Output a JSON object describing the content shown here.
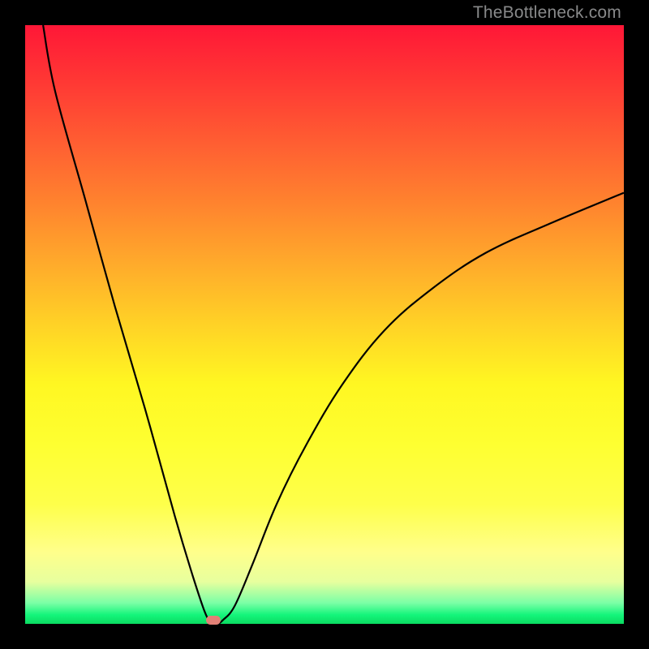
{
  "watermark": "TheBottleneck.com",
  "chart_data": {
    "type": "line",
    "title": "",
    "xlabel": "",
    "ylabel": "",
    "xlim": [
      0,
      100
    ],
    "ylim": [
      0,
      100
    ],
    "grid": false,
    "legend": false,
    "series": [
      {
        "name": "bottleneck-curve",
        "x": [
          3,
          5,
          10,
          15,
          20,
          25,
          28,
          30,
          31,
          32,
          33,
          35,
          38,
          42,
          47,
          53,
          60,
          68,
          77,
          88,
          100
        ],
        "y": [
          100,
          89,
          71,
          53,
          36,
          18,
          8,
          2,
          0.4,
          0,
          0.6,
          3,
          10,
          20,
          30,
          40,
          49,
          56,
          62,
          67,
          72
        ]
      }
    ],
    "annotations": [
      {
        "name": "min-marker",
        "x": 31.5,
        "y": 0.5,
        "color": "#e28076"
      }
    ],
    "background_gradient": {
      "direction": "vertical",
      "stops": [
        {
          "pos": 0,
          "color": "#ff1737"
        },
        {
          "pos": 50,
          "color": "#ffd226"
        },
        {
          "pos": 80,
          "color": "#feff4a"
        },
        {
          "pos": 100,
          "color": "#0bdb60"
        }
      ]
    }
  }
}
